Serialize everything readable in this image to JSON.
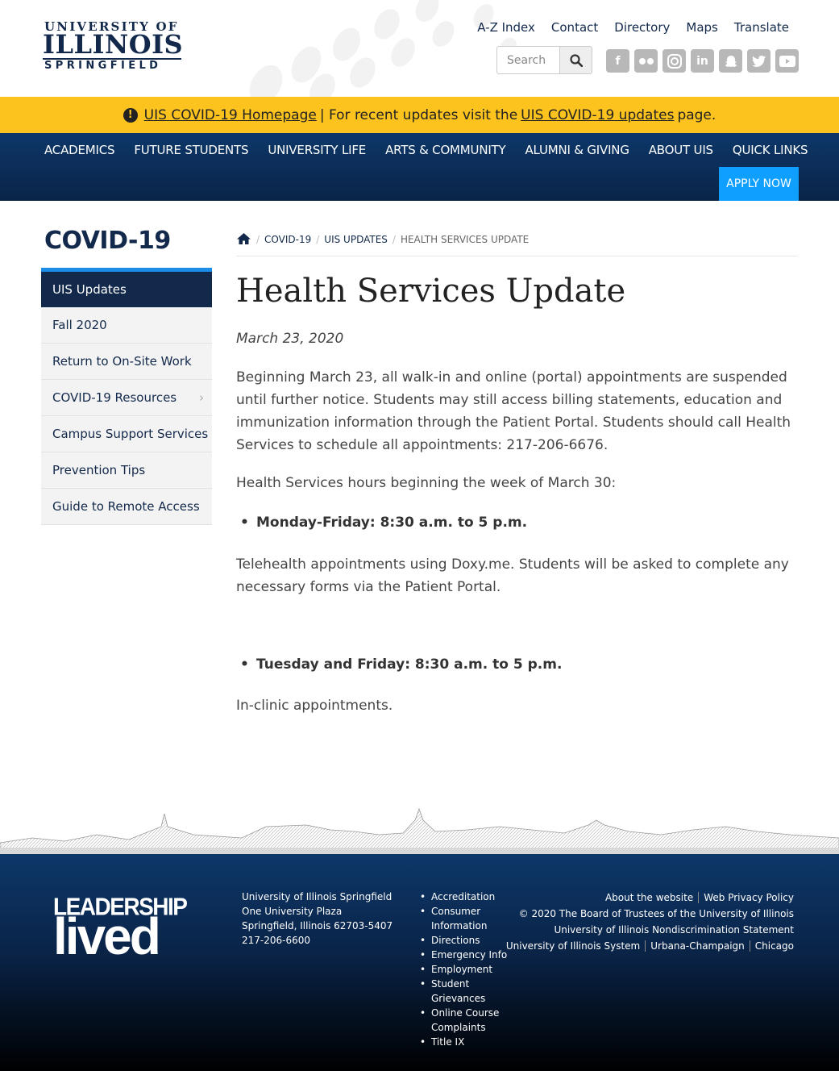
{
  "brand": {
    "line1": "UNIVERSITY OF",
    "line2": "ILLINOIS",
    "line3": "SPRINGFIELD"
  },
  "utility_nav": [
    "A-Z Index",
    "Contact",
    "Directory",
    "Maps",
    "Translate"
  ],
  "search": {
    "placeholder": "Search"
  },
  "social_icons": [
    "facebook-icon",
    "flickr-icon",
    "instagram-icon",
    "linkedin-icon",
    "snapchat-icon",
    "twitter-icon",
    "youtube-icon"
  ],
  "alert": {
    "link1": "UIS COVID-19 Homepage",
    "middle": "| For recent updates visit the",
    "link2": "UIS COVID-19 updates",
    "end": "page."
  },
  "main_nav": [
    "ACADEMICS",
    "FUTURE STUDENTS",
    "UNIVERSITY LIFE",
    "ARTS & COMMUNITY",
    "ALUMNI & GIVING",
    "ABOUT UIS",
    "QUICK LINKS"
  ],
  "apply_label": "APPLY NOW",
  "sidebar": {
    "title": "COVID-19",
    "items": [
      "UIS Updates",
      "Fall 2020",
      "Return to On-Site Work",
      "COVID-19 Resources",
      "Campus Support Services",
      "Prevention Tips",
      "Guide to Remote Access"
    ]
  },
  "breadcrumb": [
    "COVID-19",
    "UIS UPDATES",
    "HEALTH SERVICES UPDATE"
  ],
  "article": {
    "title": "Health Services Update",
    "date": "March 23, 2020",
    "p1": "Beginning March 23, all walk-in and online (portal) appointments are suspended until further notice. Students may still access billing statements, education and immunization information through the Patient Portal. Students should call Health Services to schedule all appointments: 217-206-6676.",
    "p2": "Health Services hours beginning the week of March 30:",
    "bullet1": "Monday-Friday: 8:30 a.m. to 5 p.m.",
    "p3": "Telehealth appointments using Doxy.me. Students will be asked to complete any necessary forms via the Patient Portal.",
    "bullet2": "Tuesday and Friday: 8:30 a.m. to 5 p.m.",
    "p4": "In-clinic appointments."
  },
  "footer": {
    "logo_line1": "LEADERSHIP",
    "logo_line2": "lived",
    "address": [
      "University of Illinois Springfield",
      "One University Plaza",
      "Springfield, Illinois 62703-5407",
      "217-206-6600"
    ],
    "links": [
      "Accreditation",
      "Consumer Information",
      "Directions",
      "Emergency Info",
      "Employment",
      "Student Grievances",
      "Online Course Complaints",
      "Title IX"
    ],
    "right_row1": [
      "About the website",
      "Web Privacy Policy"
    ],
    "copyright": "© 2020 The Board of Trustees of the University of Illinois",
    "nondiscrimination": "University of Illinois Nondiscrimination Statement",
    "right_row4": [
      "University of Illinois System",
      "Urbana-Champaign",
      "Chicago"
    ]
  }
}
